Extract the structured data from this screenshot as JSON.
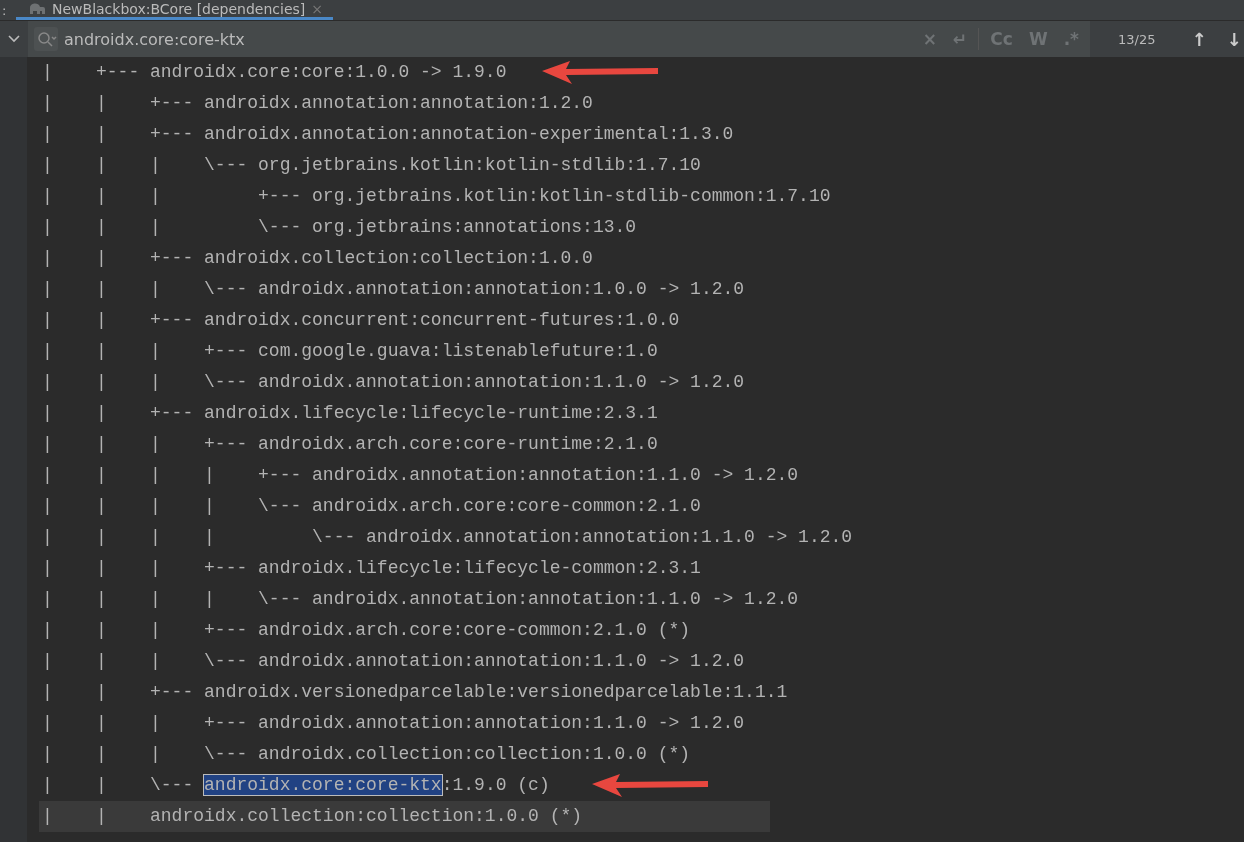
{
  "tab": {
    "title": "NewBlackbox:BCore [dependencies]",
    "selected": true,
    "close": "×"
  },
  "left_glyph": ":",
  "search": {
    "value": "androidx.core:core-ktx",
    "clear": "×",
    "newline": "↵",
    "options": [
      "Cc",
      "W",
      ".*"
    ],
    "count": "13/25",
    "prev": "↑",
    "next": "↓"
  },
  "lines": [
    {
      "text": "|    +--- androidx.core:core:1.0.0 -> 1.9.0",
      "arrow": true
    },
    {
      "text": "|    |    +--- androidx.annotation:annotation:1.2.0"
    },
    {
      "text": "|    |    +--- androidx.annotation:annotation-experimental:1.3.0"
    },
    {
      "text": "|    |    |    \\--- org.jetbrains.kotlin:kotlin-stdlib:1.7.10"
    },
    {
      "text": "|    |    |         +--- org.jetbrains.kotlin:kotlin-stdlib-common:1.7.10"
    },
    {
      "text": "|    |    |         \\--- org.jetbrains:annotations:13.0"
    },
    {
      "text": "|    |    +--- androidx.collection:collection:1.0.0"
    },
    {
      "text": "|    |    |    \\--- androidx.annotation:annotation:1.0.0 -> 1.2.0"
    },
    {
      "text": "|    |    +--- androidx.concurrent:concurrent-futures:1.0.0"
    },
    {
      "text": "|    |    |    +--- com.google.guava:listenablefuture:1.0"
    },
    {
      "text": "|    |    |    \\--- androidx.annotation:annotation:1.1.0 -> 1.2.0"
    },
    {
      "text": "|    |    +--- androidx.lifecycle:lifecycle-runtime:2.3.1"
    },
    {
      "text": "|    |    |    +--- androidx.arch.core:core-runtime:2.1.0"
    },
    {
      "text": "|    |    |    |    +--- androidx.annotation:annotation:1.1.0 -> 1.2.0"
    },
    {
      "text": "|    |    |    |    \\--- androidx.arch.core:core-common:2.1.0"
    },
    {
      "text": "|    |    |    |         \\--- androidx.annotation:annotation:1.1.0 -> 1.2.0"
    },
    {
      "text": "|    |    |    +--- androidx.lifecycle:lifecycle-common:2.3.1"
    },
    {
      "text": "|    |    |    |    \\--- androidx.annotation:annotation:1.1.0 -> 1.2.0"
    },
    {
      "text": "|    |    |    +--- androidx.arch.core:core-common:2.1.0 (*)"
    },
    {
      "text": "|    |    |    \\--- androidx.annotation:annotation:1.1.0 -> 1.2.0"
    },
    {
      "text": "|    |    +--- androidx.versionedparcelable:versionedparcelable:1.1.1"
    },
    {
      "text": "|    |    |    +--- androidx.annotation:annotation:1.1.0 -> 1.2.0"
    },
    {
      "text": "|    |    |    \\--- androidx.collection:collection:1.0.0 (*)"
    },
    {
      "text": "|    |    \\--- ",
      "match": "androidx.core:core-ktx",
      "rest": ":1.9.0 (c)",
      "arrow": true
    },
    {
      "text": "|    |    androidx.collection:collection:1.0.0 (*)",
      "current": true
    }
  ]
}
